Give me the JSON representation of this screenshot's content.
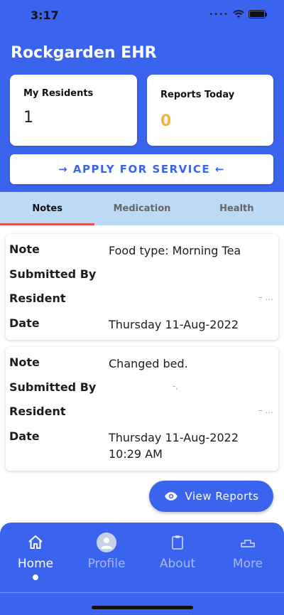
{
  "status_bar": {
    "time": "3:17"
  },
  "app": {
    "title": "Rockgarden EHR"
  },
  "stats": [
    {
      "label": "My Residents",
      "value": "1"
    },
    {
      "label": "Reports Today",
      "value": "0"
    }
  ],
  "apply_button": {
    "label": "→ APPLY FOR SERVICE ←"
  },
  "tabs": [
    {
      "label": "Notes",
      "active": true
    },
    {
      "label": "Medication",
      "active": false
    },
    {
      "label": "Health",
      "active": false
    }
  ],
  "notes": [
    {
      "labels": {
        "note": "Note",
        "submitted_by": "Submitted By",
        "resident": "Resident",
        "date": "Date"
      },
      "note": "Food type: Morning Tea",
      "submitted_by": "",
      "resident": "– ...",
      "date": "Thursday 11-Aug-2022"
    },
    {
      "labels": {
        "note": "Note",
        "submitted_by": "Submitted By",
        "resident": "Resident",
        "date": "Date"
      },
      "note": "Changed bed.",
      "submitted_by": "-,",
      "resident": "– ...",
      "date": "Thursday 11-Aug-2022\n10:29 AM"
    }
  ],
  "view_reports": {
    "label": "View Reports"
  },
  "bottom_nav": [
    {
      "label": "Home",
      "icon": "home-icon",
      "active": true
    },
    {
      "label": "Profile",
      "icon": "avatar-icon",
      "active": false
    },
    {
      "label": "About",
      "icon": "clipboard-icon",
      "active": false
    },
    {
      "label": "More",
      "icon": "more-icon",
      "active": false
    }
  ],
  "colors": {
    "primary": "#3a63ee",
    "tab_bg": "#bcd9f6",
    "tab_indicator": "#e55252",
    "reports_value": "#f2b24a"
  }
}
